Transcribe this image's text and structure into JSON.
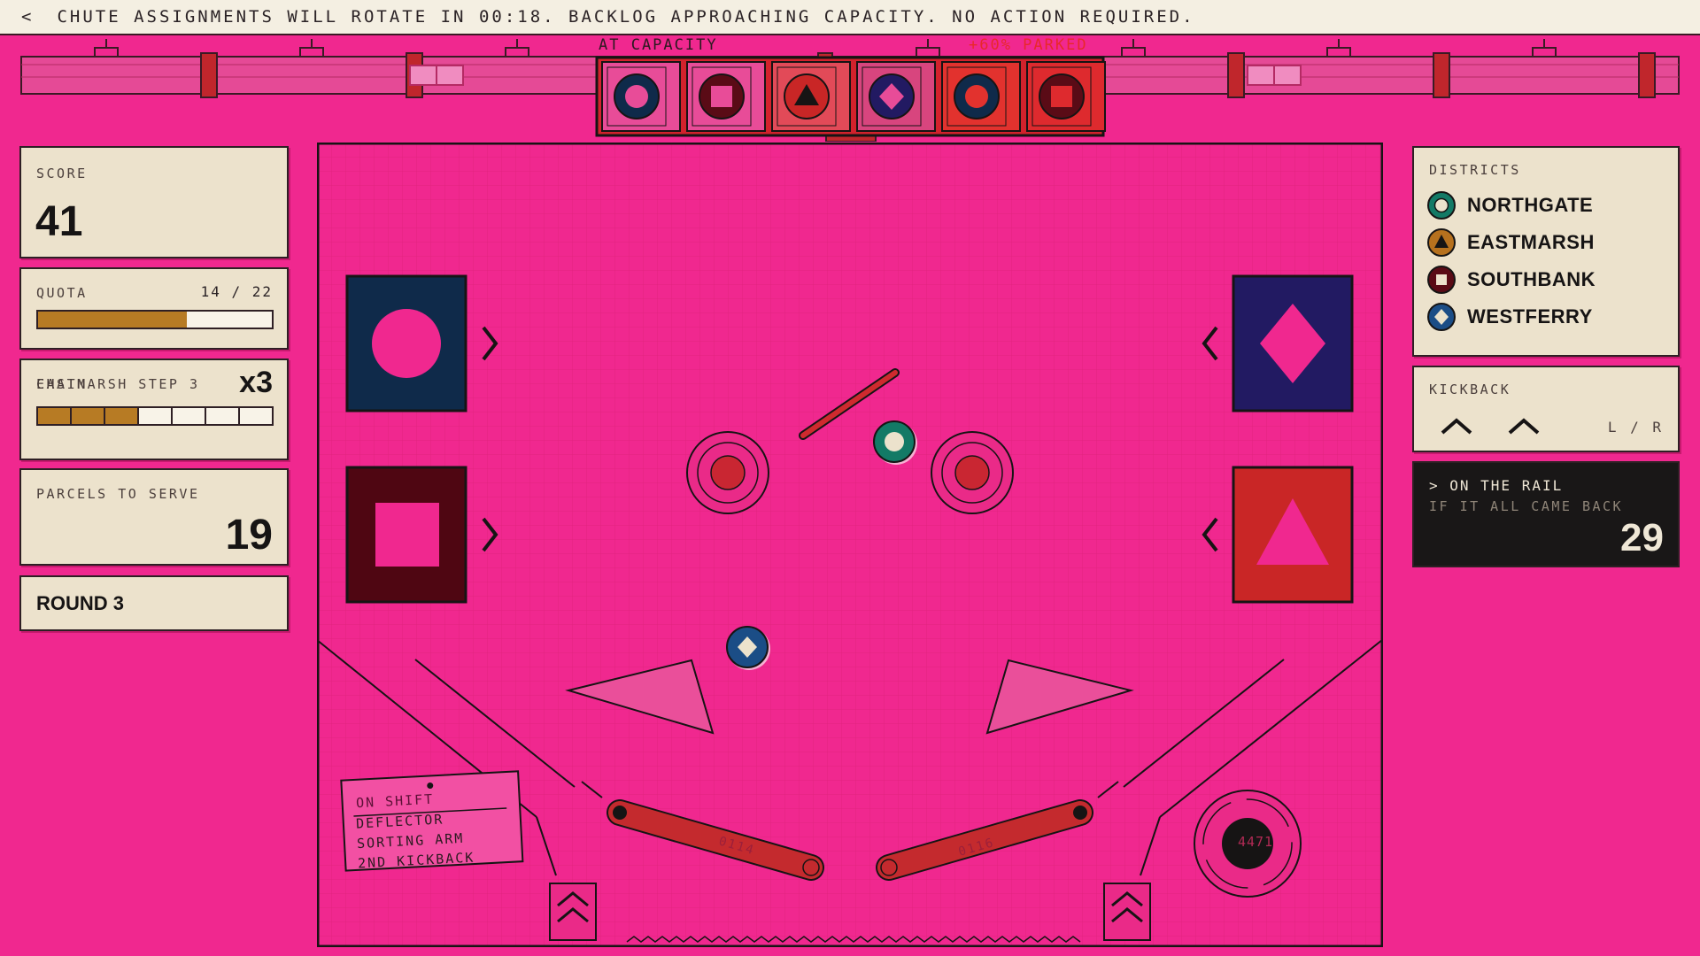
{
  "ticker": {
    "back_glyph": "<",
    "message": "CHUTE ASSIGNMENTS WILL ROTATE IN 00:18.   BACKLOG APPROACHING CAPACITY. NO ACTION REQUIRED."
  },
  "conveyor": {
    "status_left": "AT CAPACITY",
    "status_right": "+60% PARKED",
    "queue": [
      "ring-navy",
      "square-maroon",
      "triangle-red",
      "diamond-indigo",
      "ring-navy",
      "square-maroon"
    ]
  },
  "score": {
    "label": "SCORE",
    "value": "41"
  },
  "quota": {
    "label": "QUOTA",
    "count": "14 / 22",
    "progress": 0.636
  },
  "chain": {
    "label": "CHAIN",
    "multiplier": "x3",
    "steps_filled": 3,
    "steps_total": 7,
    "district_step": "EASTMARSH  STEP 3"
  },
  "parcels": {
    "label": "PARCELS TO SERVE",
    "value": "19"
  },
  "round": {
    "label": "ROUND 3"
  },
  "districts": {
    "label": "DISTRICTS",
    "items": [
      {
        "name": "NORTHGATE",
        "icon": "ring-icon",
        "color": "#137a66"
      },
      {
        "name": "EASTMARSH",
        "icon": "triangle-icon",
        "color": "#b6711e"
      },
      {
        "name": "SOUTHBANK",
        "icon": "square-icon",
        "color": "#5a0b16"
      },
      {
        "name": "WESTFERRY",
        "icon": "diamond-icon",
        "color": "#1b4d86"
      }
    ]
  },
  "kickback": {
    "label": "KICKBACK",
    "sides": "L / R"
  },
  "rail": {
    "title": "> ON THE RAIL",
    "subtitle": "IF IT ALL CAME BACK",
    "value": "29"
  },
  "playfield": {
    "on_shift_title": "ON SHIFT",
    "on_shift_items": [
      "DEFLECTOR",
      "SORTING ARM",
      "2ND KICKBACK"
    ],
    "counter": "4471",
    "flipper_left_serial": "0114",
    "flipper_right_serial": "0116"
  },
  "colors": {
    "background": "#f0288f",
    "panel": "#ece2cc",
    "ink": "#161414",
    "accent_red": "#d2222c",
    "amber": "#b77b24"
  }
}
